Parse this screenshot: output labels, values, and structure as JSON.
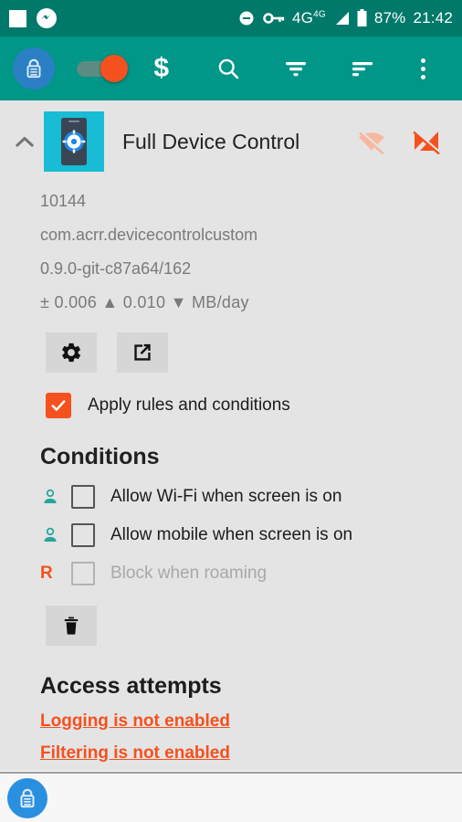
{
  "statusbar": {
    "icons_left": [
      "white-square-icon",
      "messenger-icon"
    ],
    "icons_right": [
      "do-not-disturb-icon",
      "vpn-key-icon",
      "signal-4g-icon",
      "battery-icon"
    ],
    "network_label": "4G",
    "network_sup": "4G",
    "battery": "87%",
    "clock": "21:42"
  },
  "toolbar": {
    "app_badge_icon": "lock-badge-icon",
    "toggle_state": "on",
    "toggle_name": "master-toggle",
    "dollar_label": "$",
    "icons": [
      "dollar-icon",
      "search-icon",
      "filter-icon",
      "sort-icon",
      "overflow-menu-icon"
    ]
  },
  "app": {
    "collapse_icon": "chevron-up-icon",
    "icon_name": "app-icon-device-control",
    "title": "Full Device Control",
    "wifi_status_icon": "wifi-off-icon",
    "mobile_status_icon": "mobile-data-off-icon"
  },
  "details": {
    "uid": "10144",
    "package": "com.acrr.devicecontrolcustom",
    "version": "0.9.0-git-c87a64/162",
    "usage": "± 0.006 ▲ 0.010 ▼ MB/day"
  },
  "actions": {
    "settings_icon": "gear-icon",
    "launch_icon": "open-external-icon",
    "clear_icon": "trash-icon"
  },
  "apply": {
    "label": "Apply rules and conditions",
    "checked": true
  },
  "conditions": {
    "heading": "Conditions",
    "items": [
      {
        "marker": "person-icon",
        "label": "Allow Wi-Fi when screen is on",
        "checked": false,
        "disabled": false
      },
      {
        "marker": "person-icon",
        "label": "Allow mobile when screen is on",
        "checked": false,
        "disabled": false
      },
      {
        "marker": "R",
        "label": "Block when roaming",
        "checked": false,
        "disabled": true
      }
    ]
  },
  "access": {
    "heading": "Access attempts",
    "warnings": [
      "Logging is not enabled",
      "Filtering is not enabled"
    ]
  },
  "bottombar": {
    "icon": "lock-app-icon"
  },
  "colors": {
    "statusbar": "#00796b",
    "toolbar": "#009688",
    "accent_orange": "#f4511e",
    "app_icon_bg": "#18bcd4",
    "teal_marker": "#26a69a",
    "content_bg": "#e4e4e4"
  }
}
